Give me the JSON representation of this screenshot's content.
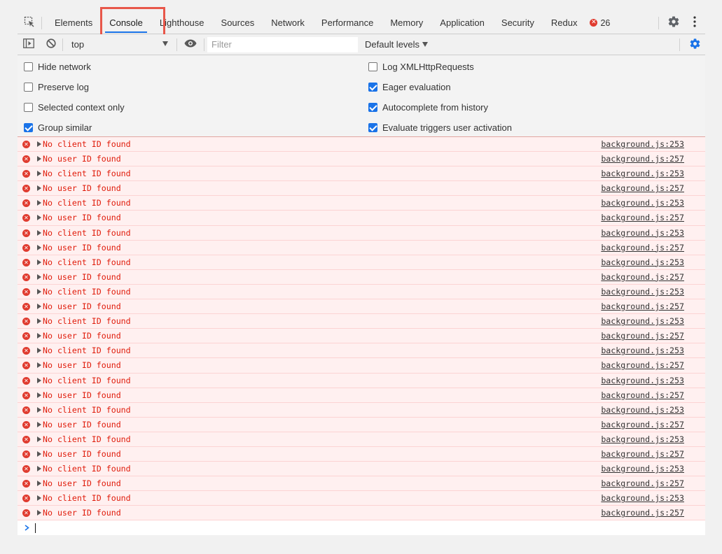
{
  "tabs": [
    {
      "label": "Elements",
      "selected": false
    },
    {
      "label": "Console",
      "selected": true
    },
    {
      "label": "Lighthouse",
      "selected": false
    },
    {
      "label": "Sources",
      "selected": false
    },
    {
      "label": "Network",
      "selected": false
    },
    {
      "label": "Performance",
      "selected": false
    },
    {
      "label": "Memory",
      "selected": false
    },
    {
      "label": "Application",
      "selected": false
    },
    {
      "label": "Security",
      "selected": false
    },
    {
      "label": "Redux",
      "selected": false
    }
  ],
  "error_badge": {
    "count": "26",
    "icon": "error-icon",
    "color": "#e03b2f"
  },
  "toolbar": {
    "context": "top",
    "filter_placeholder": "Filter",
    "levels": "Default levels"
  },
  "settings": {
    "left": [
      {
        "label": "Hide network",
        "checked": false
      },
      {
        "label": "Preserve log",
        "checked": false
      },
      {
        "label": "Selected context only",
        "checked": false
      },
      {
        "label": "Group similar",
        "checked": true
      }
    ],
    "right": [
      {
        "label": "Log XMLHttpRequests",
        "checked": false
      },
      {
        "label": "Eager evaluation",
        "checked": true
      },
      {
        "label": "Autocomplete from history",
        "checked": true
      },
      {
        "label": "Evaluate triggers user activation",
        "checked": true
      }
    ]
  },
  "messages": [
    {
      "text": "No client ID found",
      "source": "background.js:253"
    },
    {
      "text": "No user ID found",
      "source": "background.js:257"
    },
    {
      "text": "No client ID found",
      "source": "background.js:253"
    },
    {
      "text": "No user ID found",
      "source": "background.js:257"
    },
    {
      "text": "No client ID found",
      "source": "background.js:253"
    },
    {
      "text": "No user ID found",
      "source": "background.js:257"
    },
    {
      "text": "No client ID found",
      "source": "background.js:253"
    },
    {
      "text": "No user ID found",
      "source": "background.js:257"
    },
    {
      "text": "No client ID found",
      "source": "background.js:253"
    },
    {
      "text": "No user ID found",
      "source": "background.js:257"
    },
    {
      "text": "No client ID found",
      "source": "background.js:253"
    },
    {
      "text": "No user ID found",
      "source": "background.js:257"
    },
    {
      "text": "No client ID found",
      "source": "background.js:253"
    },
    {
      "text": "No user ID found",
      "source": "background.js:257"
    },
    {
      "text": "No client ID found",
      "source": "background.js:253"
    },
    {
      "text": "No user ID found",
      "source": "background.js:257"
    },
    {
      "text": "No client ID found",
      "source": "background.js:253"
    },
    {
      "text": "No user ID found",
      "source": "background.js:257"
    },
    {
      "text": "No client ID found",
      "source": "background.js:253"
    },
    {
      "text": "No user ID found",
      "source": "background.js:257"
    },
    {
      "text": "No client ID found",
      "source": "background.js:253"
    },
    {
      "text": "No user ID found",
      "source": "background.js:257"
    },
    {
      "text": "No client ID found",
      "source": "background.js:253"
    },
    {
      "text": "No user ID found",
      "source": "background.js:257"
    },
    {
      "text": "No client ID found",
      "source": "background.js:253"
    },
    {
      "text": "No user ID found",
      "source": "background.js:257"
    }
  ],
  "colors": {
    "accent": "#1a73e8",
    "error_text": "#e01b0a",
    "error_bg": "#fff0f0",
    "highlight": "#e8574a"
  }
}
